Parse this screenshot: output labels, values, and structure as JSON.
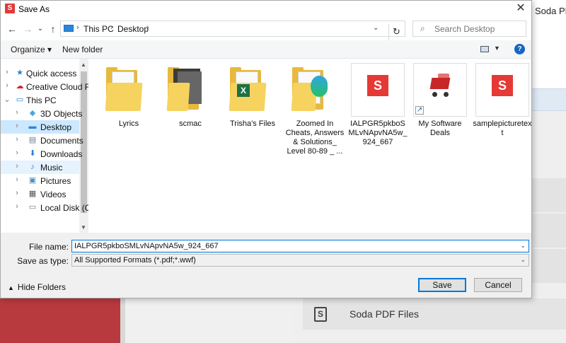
{
  "background": {
    "app_title": "Soda PDF",
    "soda_files_label": "Soda PDF Files",
    "soda_icon_letter": "S"
  },
  "dialog": {
    "title": "Save As",
    "app_icon_letter": "S",
    "close_glyph": "✕",
    "nav": {
      "back": "←",
      "forward": "→",
      "recent": "⌄",
      "up": "↑",
      "breadcrumb": [
        "This PC",
        "Desktop"
      ],
      "refresh": "↻",
      "search_placeholder": "Search Desktop",
      "search_icon": "search-icon"
    },
    "toolbar": {
      "organize": "Organize",
      "organize_caret": "▾",
      "new_folder": "New folder",
      "help": "?"
    },
    "navpane": [
      {
        "label": "Quick access",
        "icon": "star-icon",
        "chev": "›",
        "level": 0,
        "state": ""
      },
      {
        "label": "Creative Cloud Fil",
        "icon": "creative-cloud-icon",
        "chev": "›",
        "level": 0,
        "state": ""
      },
      {
        "label": "This PC",
        "icon": "computer-icon",
        "chev": "⌄",
        "level": 0,
        "state": ""
      },
      {
        "label": "3D Objects",
        "icon": "3d-objects-icon",
        "chev": "›",
        "level": 1,
        "state": ""
      },
      {
        "label": "Desktop",
        "icon": "desktop-icon",
        "chev": "›",
        "level": 1,
        "state": "selected"
      },
      {
        "label": "Documents",
        "icon": "documents-icon",
        "chev": "›",
        "level": 1,
        "state": ""
      },
      {
        "label": "Downloads",
        "icon": "downloads-icon",
        "chev": "›",
        "level": 1,
        "state": ""
      },
      {
        "label": "Music",
        "icon": "music-icon",
        "chev": "›",
        "level": 1,
        "state": "hover"
      },
      {
        "label": "Pictures",
        "icon": "pictures-icon",
        "chev": "›",
        "level": 1,
        "state": ""
      },
      {
        "label": "Videos",
        "icon": "videos-icon",
        "chev": "›",
        "level": 1,
        "state": ""
      },
      {
        "label": "Local Disk (C:)",
        "icon": "local-disk-icon",
        "chev": "›",
        "level": 1,
        "state": ""
      }
    ],
    "files": [
      {
        "name": "Lyrics",
        "kind": "folder"
      },
      {
        "name": "scmac",
        "kind": "folder-dark"
      },
      {
        "name": "Trisha's Files",
        "kind": "folder-excel"
      },
      {
        "name": "Zoomed In Cheats, Answers & Solutions_ Level 80-89 _ ...",
        "kind": "folder-edge"
      },
      {
        "name": "IALPGR5pkboSMLvNApvNA5w_924_667",
        "kind": "soda-doc"
      },
      {
        "name": "My Software Deals",
        "kind": "shortcut-cart"
      },
      {
        "name": "samplepicturetext",
        "kind": "soda-doc"
      }
    ],
    "form": {
      "file_name_label": "File name:",
      "file_name_value": "IALPGR5pkboSMLvNApvNA5w_924_667",
      "save_type_label": "Save as type:",
      "save_type_value": "All Supported Formats (*.pdf;*.wwf)",
      "hide_folders": "Hide Folders",
      "save": "Save",
      "cancel": "Cancel"
    }
  }
}
